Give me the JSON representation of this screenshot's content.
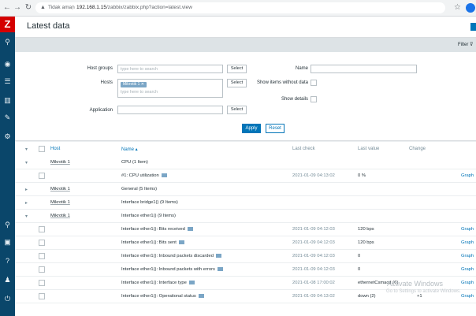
{
  "browser": {
    "security_label": "Tidak aman",
    "url_host": "192.168.1.15",
    "url_path": "/zabbix/zabbix.php?action=latest.view"
  },
  "sidebar": {
    "logo": "Z",
    "icons": [
      "search-icon",
      "monitoring-icon",
      "inventory-icon",
      "reports-icon",
      "configuration-icon",
      "administration-icon",
      "support-icon",
      "share-icon",
      "help-icon",
      "user-icon",
      "sign-out-icon"
    ]
  },
  "header": {
    "title": "Latest data"
  },
  "filter": {
    "tab_label": "Filter",
    "host_groups_label": "Host groups",
    "host_groups_placeholder": "type here to search",
    "hosts_label": "Hosts",
    "hosts_chip": "Mikrotik 1",
    "hosts_placeholder": "type here to search",
    "application_label": "Application",
    "select_label": "Select",
    "name_label": "Name",
    "show_without_data_label": "Show items without data",
    "show_details_label": "Show details",
    "apply_label": "Apply",
    "reset_label": "Reset"
  },
  "table": {
    "columns": {
      "host": "Host",
      "name": "Name ▴",
      "last_check": "Last check",
      "last_value": "Last value",
      "change": "Change"
    },
    "rows": [
      {
        "type": "group",
        "expanded": true,
        "host": "Mikrotik 1",
        "name": "CPU (1 Item)"
      },
      {
        "type": "item",
        "name": "#1: CPU utilization",
        "last_check": "2021-01-09 04:13:02",
        "last_value": "0 %",
        "change": "",
        "action": "Graph"
      },
      {
        "type": "group",
        "expanded": false,
        "host": "Mikrotik 1",
        "name": "General (5 Items)"
      },
      {
        "type": "group",
        "expanded": false,
        "host": "Mikrotik 1",
        "name": "Interface bridge1() (9 Items)"
      },
      {
        "type": "group",
        "expanded": true,
        "host": "Mikrotik 1",
        "name": "Interface ether1() (9 Items)"
      },
      {
        "type": "item",
        "name": "Interface ether1(): Bits received",
        "last_check": "2021-01-09 04:12:03",
        "last_value": "120 bps",
        "change": "",
        "action": "Graph"
      },
      {
        "type": "item",
        "name": "Interface ether1(): Bits sent",
        "last_check": "2021-01-09 04:12:03",
        "last_value": "120 bps",
        "change": "",
        "action": "Graph"
      },
      {
        "type": "item",
        "name": "Interface ether1(): Inbound packets discarded",
        "last_check": "2021-01-09 04:12:03",
        "last_value": "0",
        "change": "",
        "action": "Graph"
      },
      {
        "type": "item",
        "name": "Interface ether1(): Inbound packets with errors",
        "last_check": "2021-01-09 04:12:03",
        "last_value": "0",
        "change": "",
        "action": "Graph"
      },
      {
        "type": "item",
        "name": "Interface ether1(): Interface type",
        "last_check": "2021-01-08 17:00:02",
        "last_value": "ethernetCsmacd (6)",
        "change": "",
        "action": "Graph"
      },
      {
        "type": "item",
        "name": "Interface ether1(): Operational status",
        "last_check": "2021-01-09 04:13:02",
        "last_value": "down (2)",
        "change": "+1",
        "action": "Graph"
      }
    ]
  },
  "watermark": {
    "line1": "Activate Windows",
    "line2": "Go to Settings to activate Windows."
  }
}
